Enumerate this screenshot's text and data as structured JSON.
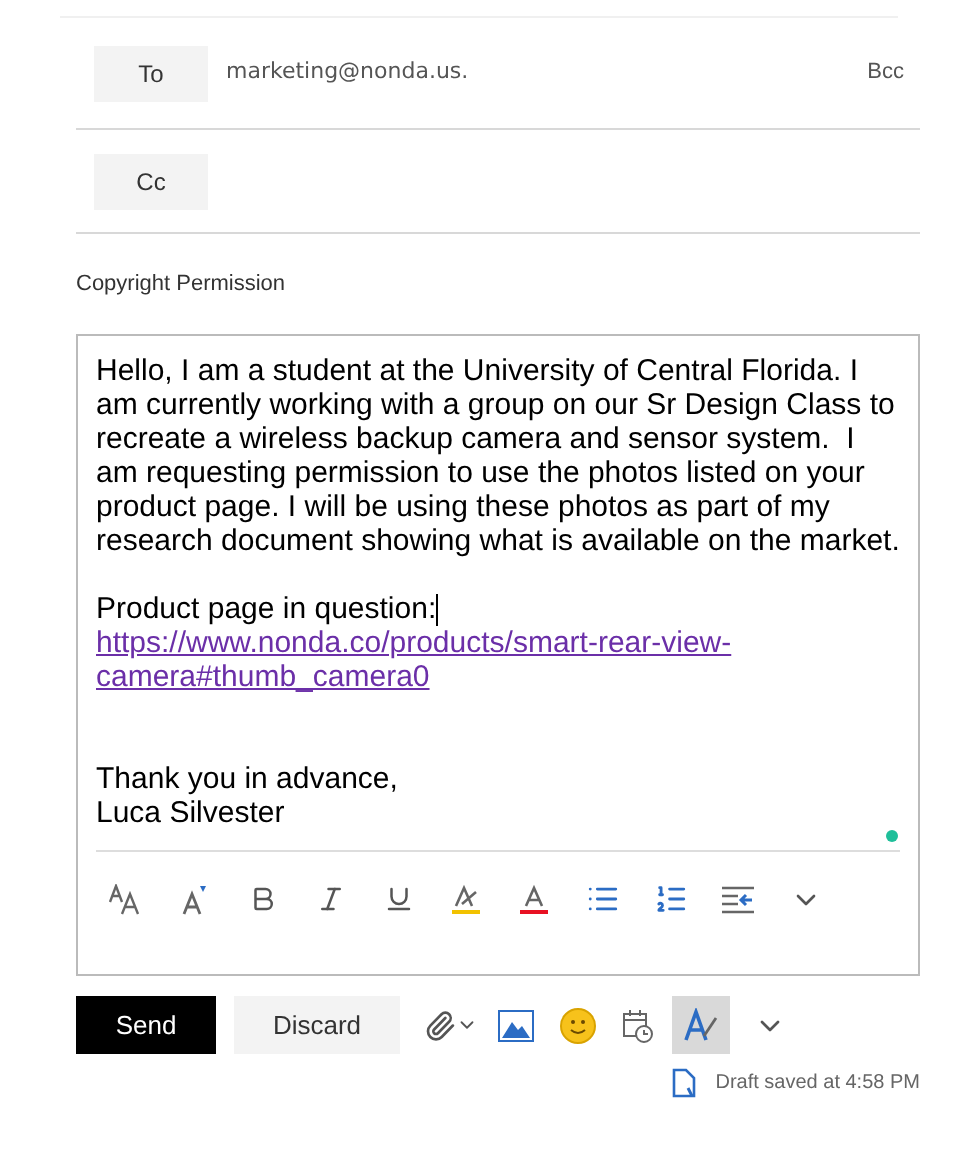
{
  "to": {
    "label": "To",
    "value": "marketing@nonda.us.",
    "bcc": "Bcc"
  },
  "cc": {
    "label": "Cc"
  },
  "subject": "Copyright Permission",
  "body": {
    "paragraphs": [
      "Hello, I am a student at the University of Central Florida. I am currently working with a group on our Sr Design Class to recreate a wireless backup camera and sensor system.  I am requesting permission to use the photos listed on your product page. I will be using these photos as part of my research document showing what is available on the market."
    ],
    "link_label": "Product page in question:",
    "link": [
      "https://www.nonda.co/products/smart-rear-view-",
      "camera#thumb_camera0"
    ],
    "closing": [
      "Thank you in advance,",
      "Luca Silvester"
    ]
  },
  "actions": {
    "send": "Send",
    "discard": "Discard",
    "signature_selected": true
  },
  "status": "Draft saved at 4:58 PM"
}
